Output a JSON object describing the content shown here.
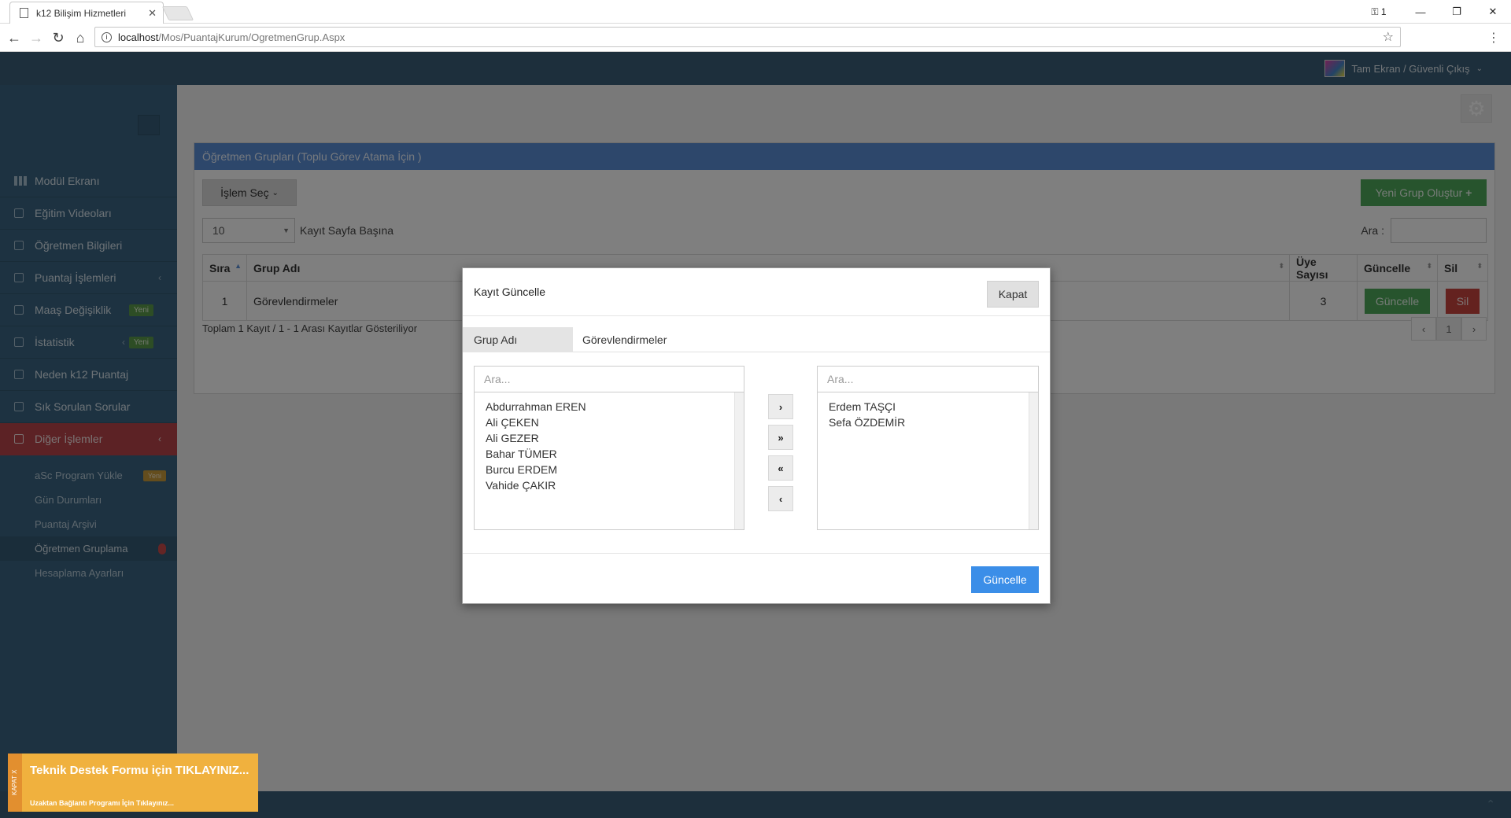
{
  "browser": {
    "tab_title": "k12 Bilişim Hizmetleri",
    "tab_close": "✕",
    "url_host": "localhost",
    "url_path": "/Mos/PuantajKurum/OgretmenGrup.Aspx",
    "profile_count": "1",
    "win_min": "—",
    "win_restore": "❐",
    "win_close": "✕"
  },
  "header": {
    "user_link": "Tam Ekran / Güvenli Çıkış"
  },
  "sidebar": {
    "items": [
      {
        "label": "Modül Ekranı"
      },
      {
        "label": "Eğitim Videoları"
      },
      {
        "label": "Öğretmen Bilgileri"
      },
      {
        "label": "Puantaj İşlemleri"
      },
      {
        "label": "Maaş Değişiklik",
        "badge": "Yeni"
      },
      {
        "label": "İstatistik",
        "badge": "Yeni"
      },
      {
        "label": "Neden k12 Puantaj"
      },
      {
        "label": "Sık Sorulan Sorular"
      },
      {
        "label": "Diğer İşlemler"
      }
    ],
    "sub_items": [
      {
        "label": "aSc Program Yükle",
        "badge": "Yeni"
      },
      {
        "label": "Gün Durumları"
      },
      {
        "label": "Puantaj Arşivi"
      },
      {
        "label": "Öğretmen Gruplama"
      },
      {
        "label": "Hesaplama Ayarları"
      }
    ]
  },
  "panel": {
    "title": "Öğretmen Grupları (Toplu Görev Atama İçin )",
    "action_btn": "İşlem Seç",
    "new_btn": "Yeni Grup Oluştur",
    "page_size": "10",
    "page_size_label": "Kayıt Sayfa Başına",
    "search_label": "Ara :",
    "columns": [
      "Sıra",
      "Grup Adı",
      "Üye Sayısı",
      "Güncelle",
      "Sil"
    ],
    "rows": [
      {
        "no": "1",
        "name": "Görevlendirmeler",
        "members": "3",
        "update": "Güncelle",
        "delete": "Sil"
      }
    ],
    "info": "Toplam 1 Kayıt / 1 - 1 Arası Kayıtlar Gösteriliyor",
    "pager": [
      "‹",
      "1",
      "›"
    ]
  },
  "support": {
    "side": "KAPAT X",
    "line1": "Teknik Destek Formu için TIKLAYINIZ...",
    "line2": "Uzaktan Bağlantı Programı İçin Tıklayınız..."
  },
  "modal": {
    "title": "Kayıt Güncelle",
    "close_btn": "Kapat",
    "group_label": "Grup Adı",
    "group_value": "Görevlendirmeler",
    "left_placeholder": "Ara...",
    "right_placeholder": "Ara...",
    "available": [
      "Abdurrahman EREN",
      "Ali ÇEKEN",
      "Ali GEZER",
      "Bahar TÜMER",
      "Burcu ERDEM",
      "Vahide ÇAKIR"
    ],
    "selected": [
      "Erdem TAŞÇI",
      "Sefa ÖZDEMİR"
    ],
    "move_right": "›",
    "move_all_right": "»",
    "move_all_left": "«",
    "move_left": "‹",
    "submit_btn": "Güncelle"
  }
}
